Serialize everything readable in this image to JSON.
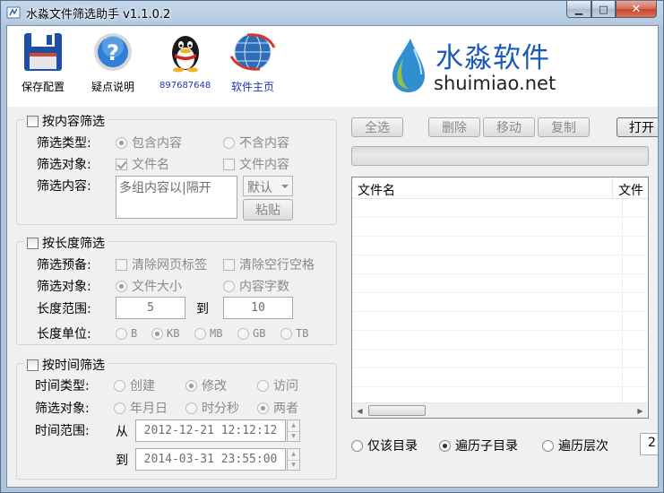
{
  "window": {
    "title": "水淼文件筛选助手 v1.1.0.2",
    "controls": {
      "minimize": "▁",
      "maximize": "□",
      "close": "✕"
    }
  },
  "toolbar": {
    "save": "保存配置",
    "help": "疑点说明",
    "qq": "897687648",
    "home": "软件主页"
  },
  "brand": {
    "title": "水淼软件",
    "subtitle": "shuimiao.net"
  },
  "content_filter": {
    "title": "按内容筛选",
    "checked": false,
    "type_label": "筛选类型:",
    "type_include": "包含内容",
    "type_exclude": "不含内容",
    "object_label": "筛选对象:",
    "object_filename": "文件名",
    "object_filecontent": "文件内容",
    "content_label": "筛选内容:",
    "content_value": "多组内容以|隔开",
    "default_select": "默认",
    "paste_button": "粘贴"
  },
  "length_filter": {
    "title": "按长度筛选",
    "checked": false,
    "preset_label": "筛选预备:",
    "preset_strip_tags": "清除网页标签",
    "preset_strip_blank": "清除空行空格",
    "object_label": "筛选对象:",
    "object_size": "文件大小",
    "object_chars": "内容字数",
    "range_label": "长度范围:",
    "range_from": "5",
    "range_to_label": "到",
    "range_to": "10",
    "unit_label": "长度单位:",
    "units": [
      "B",
      "KB",
      "MB",
      "GB",
      "TB"
    ],
    "selected_unit": "KB"
  },
  "time_filter": {
    "title": "按时间筛选",
    "checked": false,
    "type_label": "时间类型:",
    "type_created": "创建",
    "type_modified": "修改",
    "type_accessed": "访问",
    "object_label": "筛选对象:",
    "object_date": "年月日",
    "object_time": "时分秒",
    "object_both": "两者",
    "range_label": "时间范围:",
    "from_label": "从",
    "from_value": "2012-12-21 12:12:12",
    "to_label": "到",
    "to_value": "2014-03-31 23:55:00"
  },
  "actions": {
    "select_all": "全选",
    "delete": "删除",
    "move": "移动",
    "copy": "复制",
    "open": "打开"
  },
  "file_list": {
    "columns": [
      "文件名",
      "文件"
    ]
  },
  "scan": {
    "only_dir": "仅该目录",
    "recurse": "遍历子目录",
    "levels": "遍历层次",
    "selected": "遍历子目录",
    "level_value": "2"
  }
}
